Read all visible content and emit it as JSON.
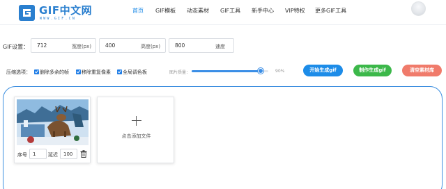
{
  "header": {
    "logo_text": "GIF中文网",
    "logo_url": "WWW.GIF.CN",
    "nav": [
      {
        "label": "首页",
        "active": true
      },
      {
        "label": "GIF模板",
        "active": false
      },
      {
        "label": "动态素材",
        "active": false
      },
      {
        "label": "GIF工具",
        "active": false
      },
      {
        "label": "新手中心",
        "active": false
      },
      {
        "label": "VIP特权",
        "active": false
      },
      {
        "label": "更多GIF工具",
        "active": false
      }
    ]
  },
  "settings": {
    "label": "GIF设置：",
    "width_value": "712",
    "width_unit": "宽度(px)",
    "height_value": "400",
    "height_unit": "高度(px)",
    "speed_value": "800",
    "speed_unit": "速度"
  },
  "options": {
    "label": "压缩选项：",
    "checkboxes": [
      {
        "label": "删除多余的帧",
        "checked": true
      },
      {
        "label": "移除重复像素",
        "checked": true
      },
      {
        "label": "全局调色板",
        "checked": true
      }
    ],
    "quality_label": "图片质量：",
    "quality_value": "90%",
    "quality_fraction": 0.9
  },
  "buttons": {
    "start": "开始生成gif",
    "generate": "制作生成gif",
    "clear": "清空素材库"
  },
  "colors": {
    "accent": "#1d8ce8",
    "green": "#3cb84a",
    "red": "#f07b6b"
  },
  "frames": [
    {
      "seq_label": "序号",
      "seq_value": "1",
      "delay_label": "延迟",
      "delay_value": "100"
    }
  ],
  "add_file_label": "点击添加文件"
}
